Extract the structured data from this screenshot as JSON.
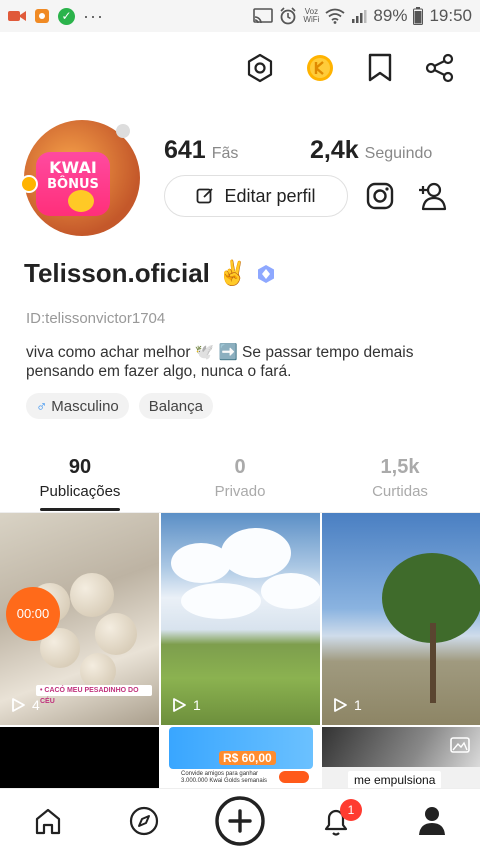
{
  "status_bar": {
    "battery": "89%",
    "time": "19:50",
    "carrier_top": "Voz",
    "carrier_bottom": "WiFi",
    "more": "···"
  },
  "profile": {
    "avatar_text_line1": "KWAI",
    "avatar_text_line2": "BÔNUS",
    "followers_count": "641",
    "followers_label": "Fãs",
    "following_count": "2,4k",
    "following_label": "Seguindo",
    "edit_label": "Editar perfil",
    "name": "Telisson.oficial",
    "name_emoji": "✌️",
    "user_id": "ID:telissonvictor1704",
    "bio": "viva como achar melhor 🕊️ ➡️ Se passar tempo demais pensando em fazer algo, nunca o fará.",
    "chips": [
      {
        "icon": "male-icon",
        "symbol": "♂",
        "label": "Masculino"
      },
      {
        "label": "Balança"
      }
    ]
  },
  "tabs": [
    {
      "count": "90",
      "label": "Publicações",
      "active": true
    },
    {
      "count": "0",
      "label": "Privado",
      "active": false
    },
    {
      "count": "1,5k",
      "label": "Curtidas",
      "active": false
    }
  ],
  "grid": {
    "cells": [
      {
        "plays": "4",
        "timer": "00:00",
        "caption": "• CACÓ MEU PESADINHO DO CÉU"
      },
      {
        "plays": "1"
      },
      {
        "plays": "1"
      },
      {},
      {
        "amount": "R$ 60,00",
        "message_line1": "Convide amigos para ganhar",
        "message_line2": "3.000.000 Kwai Golds semanais"
      },
      {
        "tag": "me empulsiona"
      }
    ]
  },
  "bottom_nav": {
    "notification_count": "1",
    "items": [
      "home-icon",
      "discover-icon",
      "create-icon",
      "notifications-icon",
      "profile-icon"
    ]
  },
  "colors": {
    "accent": "#ff6a1a",
    "badge": "#ff3b30",
    "coin": "#ffb300",
    "wifi_status_green": "#2bb34b"
  }
}
